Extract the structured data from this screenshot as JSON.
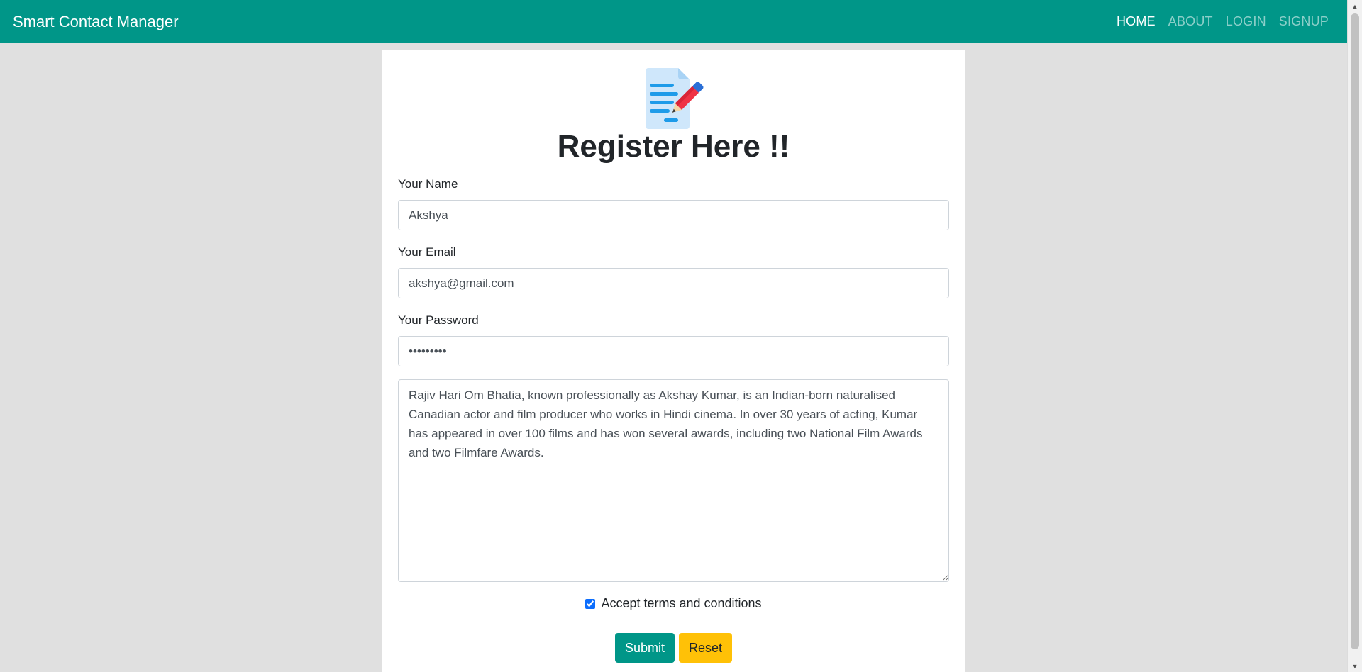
{
  "navbar": {
    "brand": "Smart Contact Manager",
    "links": [
      {
        "label": "HOME",
        "active": true
      },
      {
        "label": "ABOUT",
        "active": false
      },
      {
        "label": "LOGIN",
        "active": false
      },
      {
        "label": "SIGNUP",
        "active": false
      }
    ],
    "background_color": "#009688"
  },
  "form": {
    "logo_icon": "document-edit-icon",
    "title": "Register Here !!",
    "name": {
      "label": "Your Name",
      "value": "Akshya"
    },
    "email": {
      "label": "Your Email",
      "value": "akshya@gmail.com"
    },
    "password": {
      "label": "Your Password",
      "value": "•••••••••"
    },
    "about": {
      "value": "Rajiv Hari Om Bhatia, known professionally as Akshay Kumar, is an Indian-born naturalised Canadian actor and film producer who works in Hindi cinema. In over 30 years of acting, Kumar has appeared in over 100 films and has won several awards, including two National Film Awards and two Filmfare Awards."
    },
    "terms": {
      "label": "Accept terms and conditions",
      "checked": true
    },
    "submit_label": "Submit",
    "reset_label": "Reset",
    "submit_color": "#009688",
    "reset_color": "#ffc107"
  },
  "page": {
    "background_color": "#e0e0e0"
  }
}
